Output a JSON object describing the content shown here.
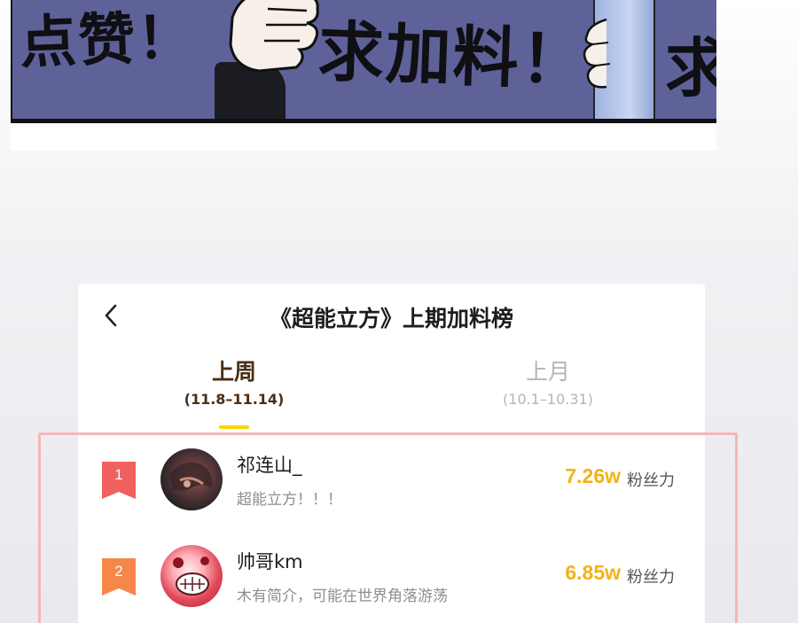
{
  "comic": {
    "text_left": "点赞！",
    "text_middle": "求加料！",
    "text_right": "求"
  },
  "header": {
    "back_icon": "chevron-left-icon",
    "title": "《超能立方》上期加料榜"
  },
  "tabs": [
    {
      "label": "上周",
      "range": "(11.8–11.14)",
      "active": true
    },
    {
      "label": "上月",
      "range": "(10.1–10.31)",
      "active": false
    }
  ],
  "colors": {
    "accent_yellow": "#ffd400",
    "power_orange": "#f3b215",
    "rank1_badge": "#f0605f",
    "rank2_badge": "#f5874a",
    "highlight_border": "#f2b7b7"
  },
  "ranking": [
    {
      "rank": "1",
      "name": "祁连山_",
      "bio": "超能立方！！！",
      "power": "7.26w",
      "unit": "粉丝力"
    },
    {
      "rank": "2",
      "name": "帅哥km",
      "bio": "木有简介，可能在世界角落游荡",
      "power": "6.85w",
      "unit": "粉丝力"
    }
  ]
}
